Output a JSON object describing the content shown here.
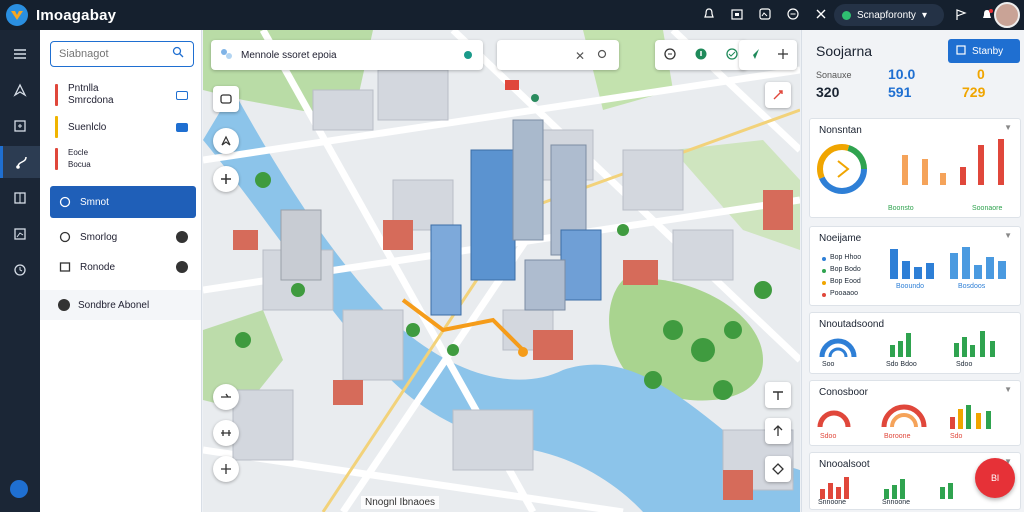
{
  "app": {
    "title": "Imoagabay"
  },
  "topbar": {
    "pill_label": "Scnapforonty"
  },
  "sidebar": {
    "search_placeholder": "Siabnagot",
    "items": [
      {
        "label": "Pntnlla",
        "label2": "Smrcdona",
        "color": "#e0473b"
      },
      {
        "label": "Suenlclo",
        "color": "#f0b400"
      },
      {
        "label": "Eocle",
        "label2": "Bocua",
        "color": "#e0473b"
      },
      {
        "label": "Smnot"
      },
      {
        "label": "Smorlog"
      },
      {
        "label": "Ronode"
      }
    ],
    "footer_label": "Sondbre Abonel"
  },
  "map": {
    "search_text": "Mennole ssoret epoia",
    "bottom_label": "Nnognl Ibnaoes"
  },
  "panel": {
    "title": "Soojarna",
    "button_label": "Stanby",
    "stats": [
      {
        "label": "Sonauxe",
        "value": "320",
        "top": "10.0",
        "color": "#1b2533"
      },
      {
        "label": "",
        "value": "591",
        "color": "#1f6fd1"
      },
      {
        "label": "",
        "value": "729",
        "top": "0",
        "color": "#f0a500"
      }
    ],
    "cards": [
      {
        "title": "Nonsntan",
        "footer_left": "Boonsto",
        "footer_right": "Soonaore"
      },
      {
        "title": "Noeijame",
        "legend": [
          "Bop Hhoo",
          "Bop Bodo",
          "Bop Eood",
          "Pooaaoo"
        ],
        "footer_left": "Booundo",
        "footer_right": "Bosdoos"
      },
      {
        "title": "Nnoutadsoond",
        "footer_left": "Soo",
        "footer_mid": "Sdo Bdoo",
        "footer_right": "Sdoo"
      },
      {
        "title": "Conosboor",
        "footer_left": "Sdoo",
        "footer_mid": "Boroone",
        "footer_right": "Sdo"
      },
      {
        "title": "Nnooalsoot",
        "footer_left": "Snnoone",
        "footer_mid": "Snnoone"
      }
    ],
    "fab_label": "Bl"
  },
  "colors": {
    "accent": "#1f6fd1",
    "red": "#e0473b",
    "orange": "#f0a500",
    "green": "#2fa34f"
  }
}
